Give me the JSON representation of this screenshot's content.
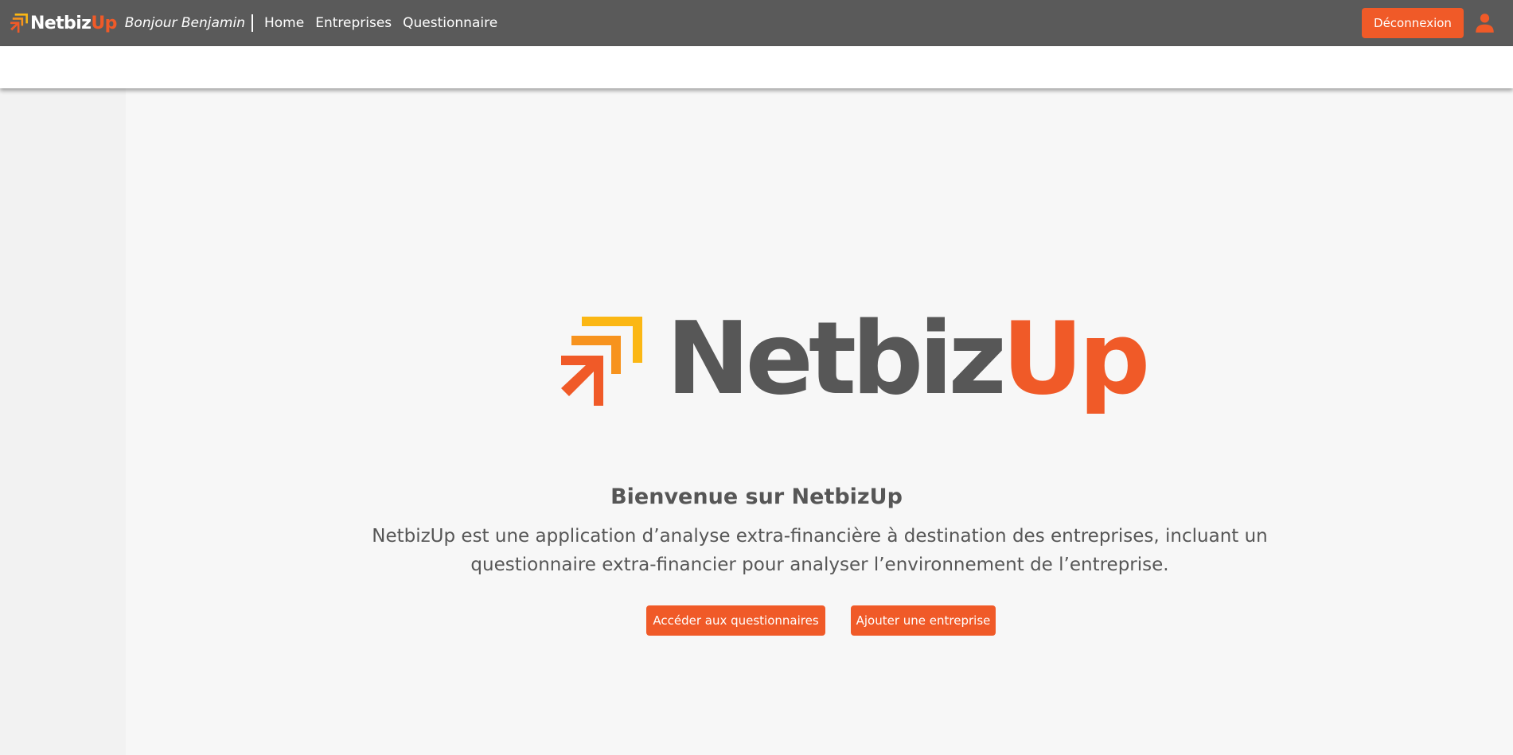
{
  "header": {
    "brand_primary": "Netbiz",
    "brand_accent": "Up",
    "greeting": "Bonjour Benjamin",
    "nav": [
      {
        "label": "Home"
      },
      {
        "label": "Entreprises"
      },
      {
        "label": "Questionnaire"
      }
    ],
    "logout_label": "Déconnexion",
    "user_icon": "user-icon"
  },
  "hero": {
    "logo_primary": "Netbiz",
    "logo_accent": "Up",
    "logo_icon": "arrows-up-right-icon"
  },
  "welcome": {
    "title": "Bienvenue sur NetbizUp",
    "description": "NetbizUp est une application d’analyse extra-financière à destination des entreprises, incluant un questionnaire extra-financier pour analyser l’environnement de l’entreprise."
  },
  "actions": {
    "questionnaires_label": "Accéder aux questionnaires",
    "add_company_label": "Ajouter une entreprise"
  },
  "colors": {
    "header_bg": "#5a5a5a",
    "accent": "#f05a28",
    "accent_mid": "#f7931e",
    "accent_light": "#fbb714",
    "text_dark": "#565656",
    "page_bg": "#f7f7f7"
  }
}
